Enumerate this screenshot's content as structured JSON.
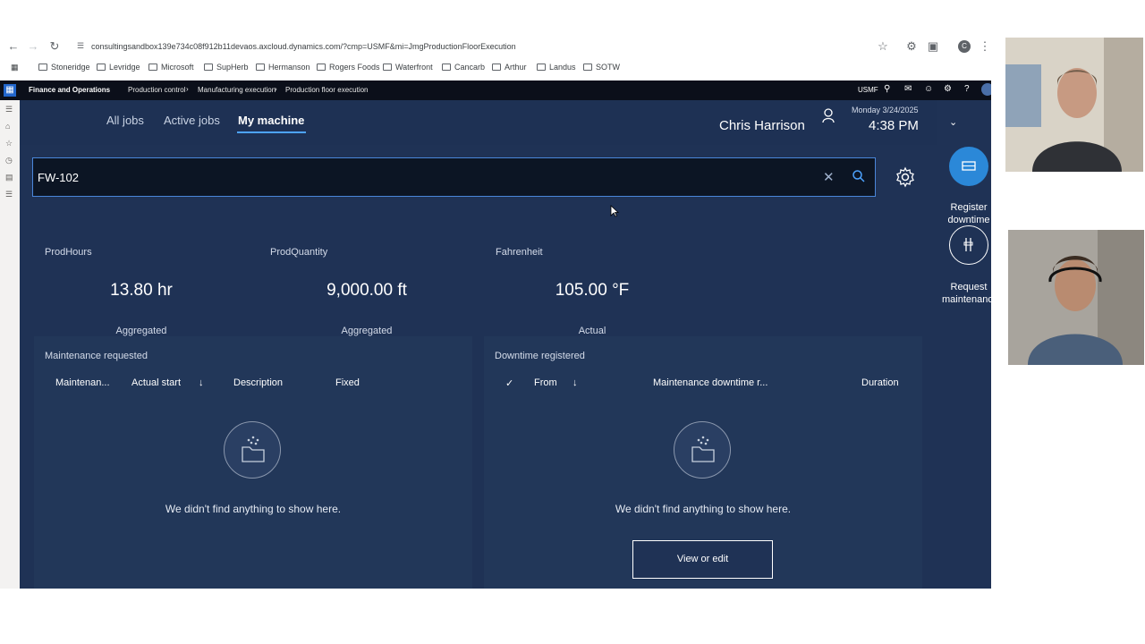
{
  "browser": {
    "url": "consultingsandbox139e734c08f912b11devaos.axcloud.dynamics.com/?cmp=USMF&mi=JmgProductionFloorExecution",
    "bookmarks": [
      "Stoneridge",
      "Levridge",
      "Microsoft",
      "SupHerb",
      "Hermanson",
      "Rogers Foods",
      "Waterfront",
      "Cancarb",
      "Arthur",
      "Landus",
      "SOTW"
    ]
  },
  "topbar": {
    "app_name": "Finance and Operations",
    "breadcrumbs": [
      "Production control",
      "Manufacturing execution",
      "Production floor execution"
    ],
    "company": "USMF"
  },
  "header": {
    "tabs": [
      "All jobs",
      "Active jobs",
      "My machine"
    ],
    "active_tab": "My machine",
    "user_name": "Chris Harrison",
    "date": "Monday 3/24/2025",
    "time": "4:38 PM"
  },
  "search": {
    "value": "FW-102"
  },
  "metrics": [
    {
      "label": "ProdHours",
      "value": "13.80 hr",
      "sub": "Aggregated"
    },
    {
      "label": "ProdQuantity",
      "value": "9,000.00 ft",
      "sub": "Aggregated"
    },
    {
      "label": "Fahrenheit",
      "value": "105.00 °F",
      "sub": "Actual"
    }
  ],
  "maintenance_panel": {
    "title": "Maintenance requested",
    "columns": [
      "Maintenan...",
      "Actual start",
      "Description",
      "Fixed"
    ],
    "empty_text": "We didn't find anything to show here."
  },
  "downtime_panel": {
    "title": "Downtime registered",
    "columns": [
      "From",
      "Maintenance downtime r...",
      "Duration"
    ],
    "empty_text": "We didn't find anything to show here.",
    "button": "View or edit"
  },
  "actions": {
    "register_line1": "Register",
    "register_line2": "downtime",
    "request_line1": "Request",
    "request_line2": "maintenance"
  },
  "colors": {
    "app_bg": "#1f3255",
    "accent": "#4da3ff",
    "topbar": "#0b0f1a"
  }
}
